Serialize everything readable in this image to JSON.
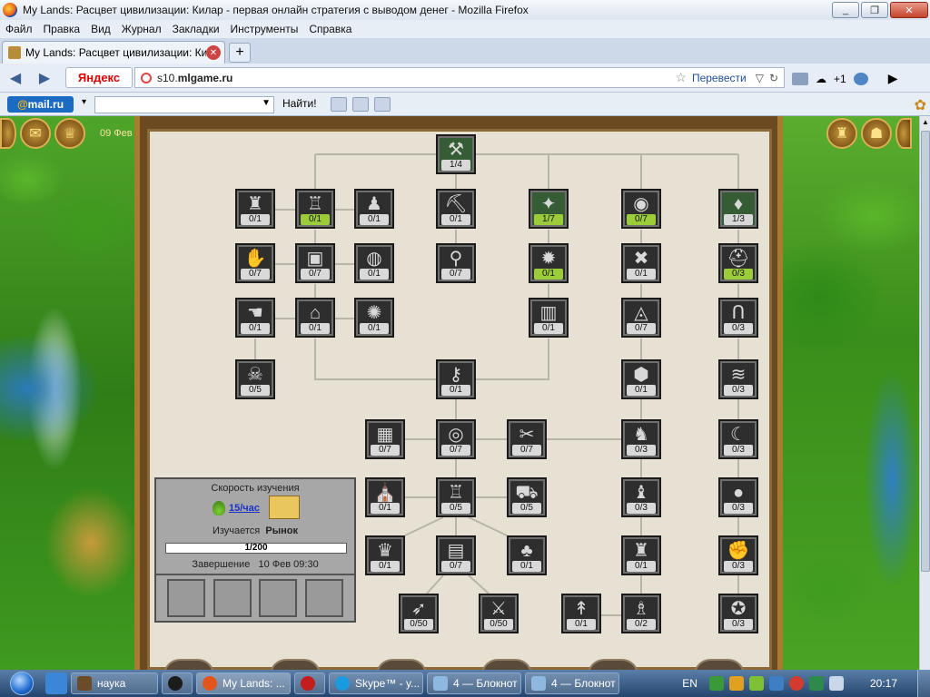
{
  "window": {
    "title": "My Lands: Расцвет цивилизации: Килар - первая онлайн стратегия с выводом денег - Mozilla Firefox"
  },
  "menu": [
    "Файл",
    "Правка",
    "Вид",
    "Журнал",
    "Закладки",
    "Инструменты",
    "Справка"
  ],
  "tab": {
    "label": "My Lands: Расцвет цивилизации: Кила..."
  },
  "nav": {
    "yandex": "Яндекс",
    "url_prefix": "s10.",
    "url_domain": "mlgame.ru",
    "translate": "Перевести",
    "weather": "+1"
  },
  "toolbar2": {
    "mailru_at": "@",
    "mailru_text": "mail.ru",
    "find": "Найти!"
  },
  "game": {
    "date": "09 Фев",
    "research_panel": {
      "speed_label": "Скорость изучения",
      "rate": "15/час",
      "studying_label": "Изучается",
      "studying_value": "Рынок",
      "progress": "1/200",
      "finish_label": "Завершение",
      "finish_value": "10 Фев 09:30"
    },
    "nodes": [
      {
        "id": "root",
        "icon": "crossed-hammers-icon",
        "glyph": "⚒",
        "count": "1/4",
        "done": false,
        "hi": true
      },
      {
        "id": "tower",
        "icon": "tower-icon",
        "glyph": "♜",
        "count": "0/1",
        "done": false
      },
      {
        "id": "fortress",
        "icon": "fortress-icon",
        "glyph": "♖",
        "count": "0/1",
        "done": true
      },
      {
        "id": "pawn",
        "icon": "pawn-icon",
        "glyph": "♟",
        "count": "0/1",
        "done": false
      },
      {
        "id": "shovel",
        "icon": "shovel-icon",
        "glyph": "⛏",
        "count": "0/1",
        "done": false
      },
      {
        "id": "treasure",
        "icon": "treasure-icon",
        "glyph": "✦",
        "count": "1/7",
        "done": true,
        "hi": true
      },
      {
        "id": "eye",
        "icon": "eye-icon",
        "glyph": "◉",
        "count": "0/7",
        "done": true
      },
      {
        "id": "backpack",
        "icon": "backpack-icon",
        "glyph": "♦",
        "count": "1/3",
        "done": false,
        "hi": true
      },
      {
        "id": "handshake",
        "icon": "handshake-icon",
        "glyph": "✋",
        "count": "0/7",
        "done": false
      },
      {
        "id": "chest",
        "icon": "chest-icon",
        "glyph": "▣",
        "count": "0/7",
        "done": false
      },
      {
        "id": "barrel",
        "icon": "barrel-icon",
        "glyph": "◍",
        "count": "0/1",
        "done": false
      },
      {
        "id": "hammer",
        "icon": "hammer-icon",
        "glyph": "⚲",
        "count": "0/7",
        "done": false
      },
      {
        "id": "cannon",
        "icon": "cannon-icon",
        "glyph": "✹",
        "count": "0/1",
        "done": true
      },
      {
        "id": "mask",
        "icon": "mask-icon",
        "glyph": "✖",
        "count": "0/1",
        "done": false
      },
      {
        "id": "helmet",
        "icon": "helmet-icon",
        "glyph": "⛑",
        "count": "0/3",
        "done": true
      },
      {
        "id": "hand",
        "icon": "hand-icon",
        "glyph": "☚",
        "count": "0/1",
        "done": false
      },
      {
        "id": "houses",
        "icon": "houses-icon",
        "glyph": "⌂",
        "count": "0/1",
        "done": false
      },
      {
        "id": "light",
        "icon": "light-icon",
        "glyph": "✺",
        "count": "0/1",
        "done": false
      },
      {
        "id": "buildings",
        "icon": "buildings-icon",
        "glyph": "▥",
        "count": "0/1",
        "done": false
      },
      {
        "id": "eye-pyramid",
        "icon": "eye-pyramid-icon",
        "glyph": "◬",
        "count": "0/7",
        "done": false
      },
      {
        "id": "horseshoe",
        "icon": "horseshoe-icon",
        "glyph": "Ո",
        "count": "0/3",
        "done": false
      },
      {
        "id": "monster",
        "icon": "monster-icon",
        "glyph": "☠",
        "count": "0/5",
        "done": false
      },
      {
        "id": "keys",
        "icon": "keys-icon",
        "glyph": "⚷",
        "count": "0/1",
        "done": false
      },
      {
        "id": "shield-dark",
        "icon": "shield-icon",
        "glyph": "⬢",
        "count": "0/1",
        "done": false
      },
      {
        "id": "wings",
        "icon": "wings-icon",
        "glyph": "≋",
        "count": "0/3",
        "done": false
      },
      {
        "id": "crates",
        "icon": "crates-icon",
        "glyph": "▦",
        "count": "0/7",
        "done": false
      },
      {
        "id": "scroll",
        "icon": "scroll-icon",
        "glyph": "◎",
        "count": "0/7",
        "done": false
      },
      {
        "id": "tools",
        "icon": "tools-icon",
        "glyph": "✂",
        "count": "0/7",
        "done": false
      },
      {
        "id": "knights",
        "icon": "knights-icon",
        "glyph": "♞",
        "count": "0/3",
        "done": false
      },
      {
        "id": "bow",
        "icon": "bow-icon",
        "glyph": "☾",
        "count": "0/3",
        "done": false
      },
      {
        "id": "temple",
        "icon": "temple-icon",
        "glyph": "⛪",
        "count": "0/1",
        "done": false
      },
      {
        "id": "castle",
        "icon": "castle-icon",
        "glyph": "♖",
        "count": "0/5",
        "done": false
      },
      {
        "id": "cart",
        "icon": "cart-icon",
        "glyph": "⛟",
        "count": "0/5",
        "done": false
      },
      {
        "id": "army",
        "icon": "army-icon",
        "glyph": "♝",
        "count": "0/3",
        "done": false
      },
      {
        "id": "bomb",
        "icon": "bomb-icon",
        "glyph": "●",
        "count": "0/3",
        "done": false
      },
      {
        "id": "crown",
        "icon": "crown-icon",
        "glyph": "♛",
        "count": "0/1",
        "done": false
      },
      {
        "id": "abacus",
        "icon": "abacus-icon",
        "glyph": "▤",
        "count": "0/7",
        "done": false
      },
      {
        "id": "tree",
        "icon": "tree-icon",
        "glyph": "♣",
        "count": "0/1",
        "done": false
      },
      {
        "id": "citadel",
        "icon": "citadel-icon",
        "glyph": "♜",
        "count": "0/1",
        "done": false
      },
      {
        "id": "knuckles",
        "icon": "knuckles-icon",
        "glyph": "✊",
        "count": "0/3",
        "done": false
      },
      {
        "id": "crossbow",
        "icon": "crossbow-icon",
        "glyph": "➶",
        "count": "0/50",
        "done": false
      },
      {
        "id": "sword",
        "icon": "sword-icon",
        "glyph": "⚔",
        "count": "0/50",
        "done": false
      },
      {
        "id": "spears",
        "icon": "spears-icon",
        "glyph": "↟",
        "count": "0/1",
        "done": false
      },
      {
        "id": "guard",
        "icon": "guard-icon",
        "glyph": "♗",
        "count": "0/2",
        "done": false
      },
      {
        "id": "star-circle",
        "icon": "star-circle-icon",
        "glyph": "✪",
        "count": "0/3",
        "done": false
      }
    ]
  },
  "taskbar": {
    "items": [
      {
        "label": "наука",
        "color": "#6b4c2a"
      },
      {
        "label": "",
        "color": "#1c1c1c"
      },
      {
        "label": "My Lands: ...",
        "color": "#e4551b"
      },
      {
        "label": "",
        "color": "#c31d1d"
      },
      {
        "label": "Skype™ - y...",
        "color": "#1a9be0"
      },
      {
        "label": "4 — Блокнот",
        "color": "#8fb8e0"
      },
      {
        "label": "4 — Блокнот",
        "color": "#8fb8e0"
      }
    ],
    "lang": "EN",
    "clock": "20:17"
  }
}
